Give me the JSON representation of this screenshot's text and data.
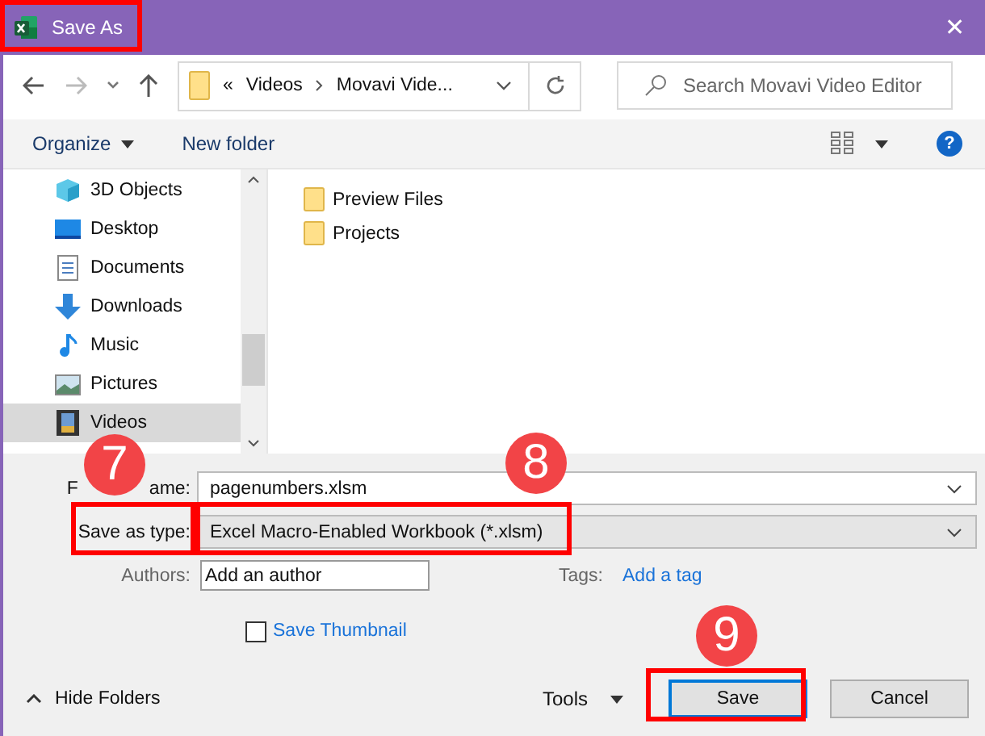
{
  "window": {
    "title": "Save As",
    "close": "✕"
  },
  "address": {
    "overflow": "«",
    "path": [
      "Videos",
      "Movavi Vide..."
    ]
  },
  "search": {
    "placeholder": "Search Movavi Video Editor"
  },
  "toolbar": {
    "organize": "Organize",
    "new_folder": "New folder",
    "help": "?"
  },
  "nav_items": [
    {
      "label": "3D Objects",
      "kind": "cube",
      "selected": false
    },
    {
      "label": "Desktop",
      "kind": "desktop",
      "selected": false
    },
    {
      "label": "Documents",
      "kind": "document",
      "selected": false
    },
    {
      "label": "Downloads",
      "kind": "download",
      "selected": false
    },
    {
      "label": "Music",
      "kind": "music",
      "selected": false
    },
    {
      "label": "Pictures",
      "kind": "pictures",
      "selected": false
    },
    {
      "label": "Videos",
      "kind": "videos",
      "selected": true
    }
  ],
  "files": [
    {
      "name": "Preview Files"
    },
    {
      "name": "Projects"
    }
  ],
  "form": {
    "file_name_label_parts": [
      "F",
      "ame:"
    ],
    "file_name": "pagenumbers.xlsm",
    "type_label": "Save as type:",
    "type_value": "Excel Macro-Enabled Workbook (*.xlsm)",
    "authors_label": "Authors:",
    "authors_placeholder": "Add an author",
    "tags_label": "Tags:",
    "tags_link": "Add a tag",
    "thumbnail_label": "Save Thumbnail",
    "thumbnail_checked": false
  },
  "footer": {
    "hide_folders": "Hide Folders",
    "tools": "Tools",
    "save": "Save",
    "cancel": "Cancel"
  },
  "callouts": [
    {
      "label": "7"
    },
    {
      "label": "8"
    },
    {
      "label": "9"
    }
  ]
}
